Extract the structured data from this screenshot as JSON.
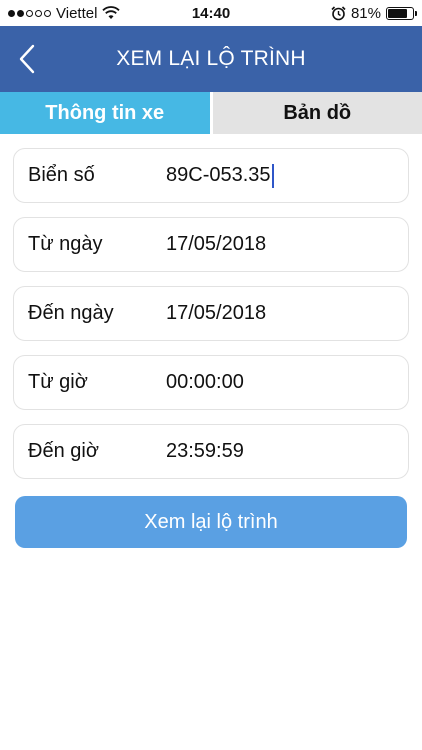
{
  "status_bar": {
    "carrier": "Viettel",
    "time": "14:40",
    "battery_percent": "81%",
    "battery_level": 0.81,
    "icons": [
      "signal-dots-icon",
      "wifi-icon",
      "alarm-icon",
      "battery-icon"
    ]
  },
  "header": {
    "title": "XEM LẠI LỘ TRÌNH",
    "back_icon": "chevron-left-icon",
    "color": "#3a62a8"
  },
  "tabs": [
    {
      "label": "Thông tin xe",
      "active": true,
      "color": "#46b8e4"
    },
    {
      "label": "Bản dồ",
      "active": false,
      "color": "#e3e3e3"
    }
  ],
  "form": {
    "plate": {
      "label": "Biển số",
      "value": "89C-053.35"
    },
    "from_date": {
      "label": "Từ ngày",
      "value": "17/05/2018"
    },
    "to_date": {
      "label": "Đến ngày",
      "value": "17/05/2018"
    },
    "from_time": {
      "label": "Từ giờ",
      "value": "00:00:00"
    },
    "to_time": {
      "label": "Đến giờ",
      "value": "23:59:59"
    }
  },
  "submit": {
    "label": "Xem lại lộ trình",
    "color": "#5aa0e3"
  }
}
